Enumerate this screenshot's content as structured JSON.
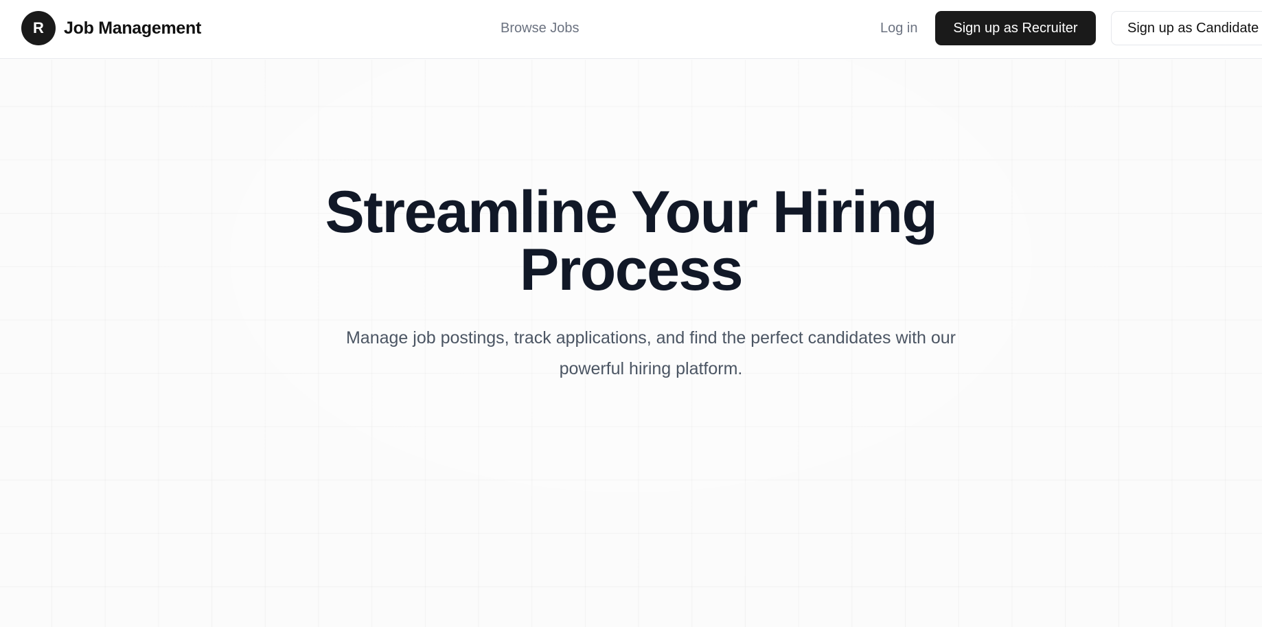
{
  "header": {
    "logo_letter": "R",
    "brand_name": "Job Management",
    "nav": {
      "browse_jobs": "Browse Jobs"
    },
    "login_label": "Log in",
    "signup_recruiter_label": "Sign up as Recruiter",
    "signup_candidate_label": "Sign up as Candidate"
  },
  "hero": {
    "headline_line1": "Streamline Your Hiring",
    "headline_line2": "Process",
    "subheadline": "Manage job postings, track applications, and find the perfect candidates with our powerful hiring platform."
  },
  "colors": {
    "primary_dark": "#1a1a1a",
    "headline": "#111827",
    "muted_text": "#6b7280",
    "subhead_text": "#4b5563",
    "hero_background": "#fbfbfb"
  }
}
